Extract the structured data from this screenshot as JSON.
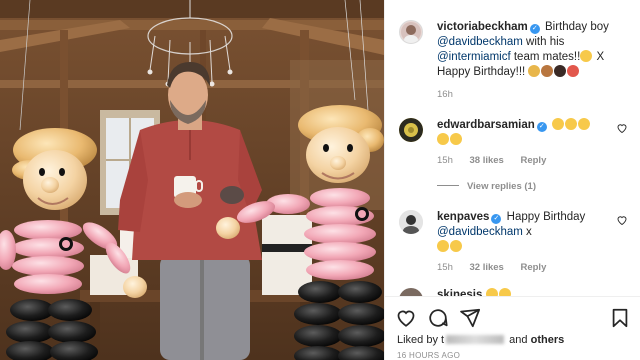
{
  "post": {
    "author": "victoriabeckham",
    "caption_pre": "Birthday boy",
    "mention_1": "@davidbeckham",
    "caption_mid": "with his",
    "mention_2": "@intermiamicf",
    "caption_post": "team mates!!",
    "caption_end": "X",
    "caption_line2": "Happy Birthday!!!",
    "time": "16h"
  },
  "comments": [
    {
      "user": "edwardbarsamian",
      "time": "15h",
      "likes": "38 likes",
      "reply": "Reply",
      "view_replies": "View replies (1)"
    },
    {
      "user": "kenpaves",
      "text_pre": "Happy Birthday",
      "mention": "@davidbeckham",
      "text_post": "x",
      "time": "15h",
      "likes": "32 likes",
      "reply": "Reply"
    },
    {
      "user": "skinesis"
    }
  ],
  "footer": {
    "liked_prefix": "Liked by",
    "liked_partial": "t",
    "liked_and": "and",
    "liked_others": "others",
    "timestamp": "16 HOURS AGO"
  },
  "icons": {
    "like": "heart-icon",
    "comment": "comment-icon",
    "share": "share-icon",
    "save": "bookmark-icon"
  },
  "colors": {
    "mention": "#00376b",
    "verified": "#3897f0",
    "meta": "#8e8e8e"
  }
}
